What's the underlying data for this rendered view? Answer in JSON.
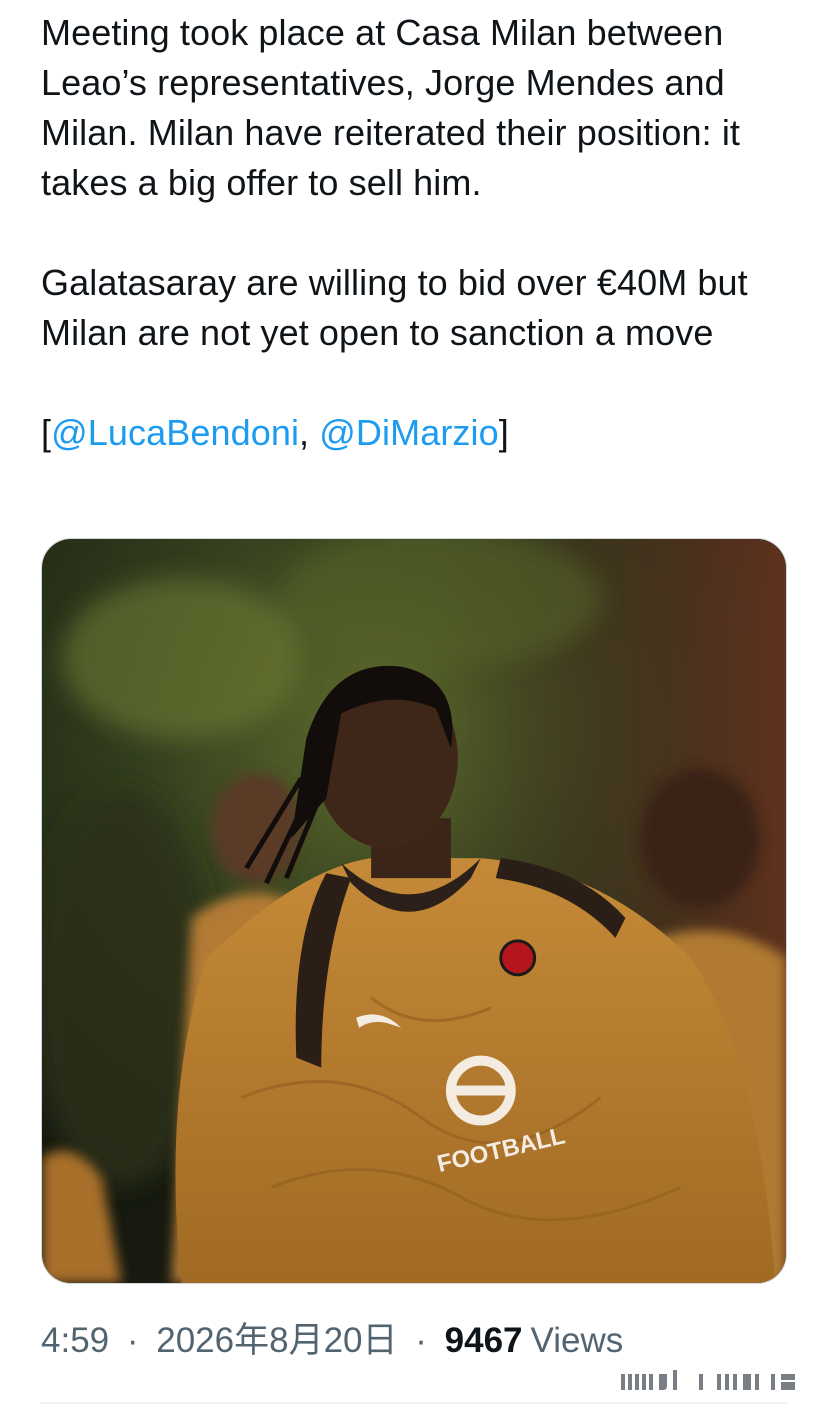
{
  "tweet": {
    "paragraph_1": "Meeting took place at Casa Milan between Leao’s representatives, Jorge Mendes and Milan. Milan have reiterated their position: it takes a big offer to sell him.",
    "paragraph_2": "Galatasaray are willing to bid over €40M but Milan are not yet open to sanction a move",
    "bracket_open": "[",
    "mention_1": "@LucaBendoni",
    "separator": ", ",
    "mention_2": "@DiMarzio",
    "bracket_close": "]"
  },
  "media": {
    "jersey_text": "FOOTBALL"
  },
  "meta": {
    "time": "4:59",
    "dot_1": "·",
    "date": "2026年8月20日",
    "dot_2": "·",
    "views_count": "9467",
    "views_label": "Views"
  },
  "colors": {
    "text": "#0f1419",
    "secondary": "#536471",
    "link": "#1d9bf0",
    "jersey": "#b07a2c"
  }
}
